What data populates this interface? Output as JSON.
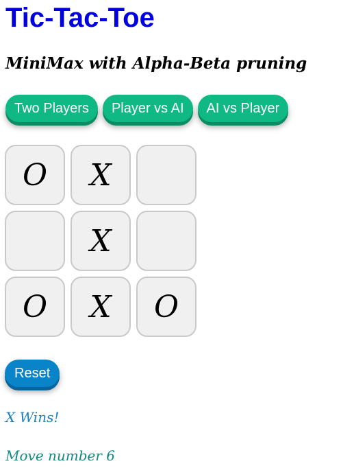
{
  "header": {
    "title": "Tic-Tac-Toe",
    "subtitle": "MiniMax with Alpha-Beta pruning"
  },
  "modes": [
    {
      "label": "Two Players"
    },
    {
      "label": "Player vs AI"
    },
    {
      "label": "AI vs Player"
    }
  ],
  "board": {
    "cells": [
      "O",
      "X",
      "",
      "",
      "X",
      "",
      "O",
      "X",
      "O"
    ]
  },
  "controls": {
    "reset_label": "Reset"
  },
  "status": {
    "result": "X Wins!",
    "move": "Move number 6"
  },
  "colors": {
    "title": "#0000e0",
    "mode_button": "#10b884",
    "reset_button": "#0a84c8",
    "result_text": "#1c7fc0",
    "move_text": "#108a80"
  }
}
